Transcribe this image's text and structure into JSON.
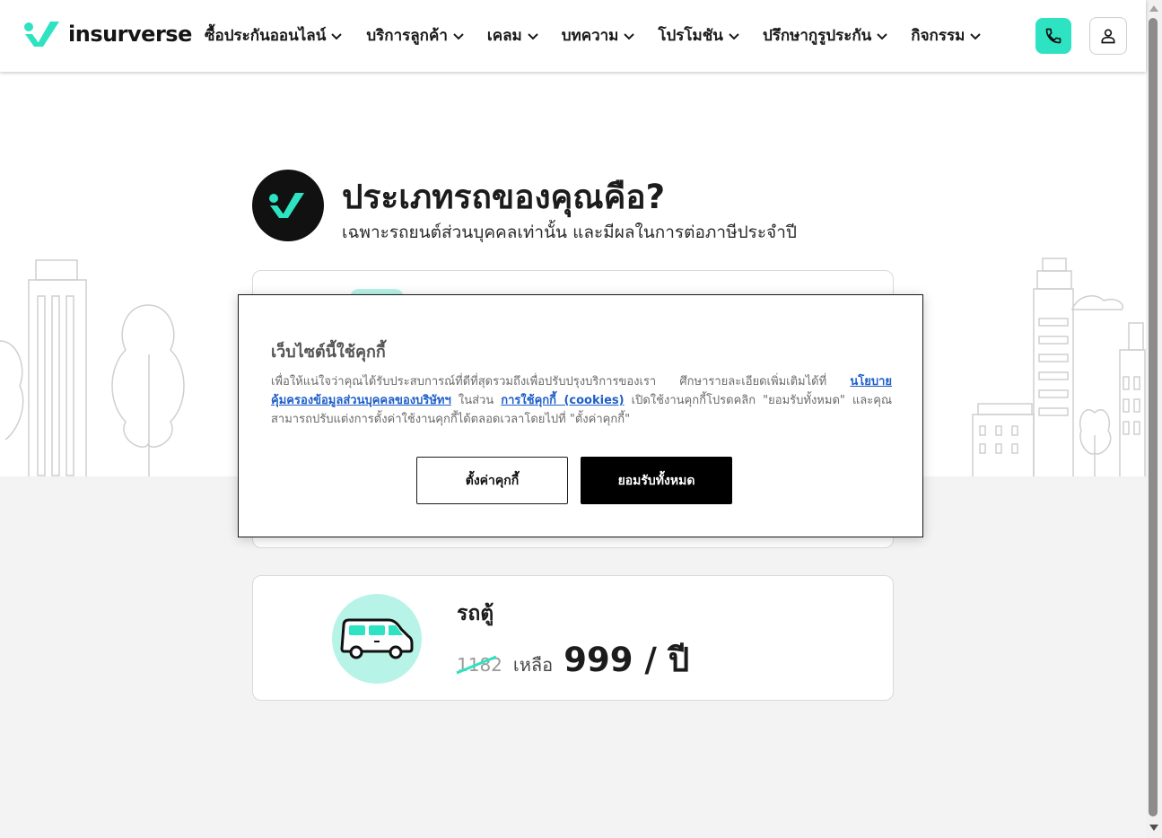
{
  "brand": {
    "name": "insurverse",
    "accent": "#2de3c1"
  },
  "nav": {
    "items": [
      {
        "label": "ซื้อประกันออนไลน์"
      },
      {
        "label": "บริการลูกค้า"
      },
      {
        "label": "เคลม"
      },
      {
        "label": "บทความ"
      },
      {
        "label": "โปรโมชัน"
      },
      {
        "label": "ปรึกษากูรูประกัน"
      },
      {
        "label": "กิจกรรม"
      }
    ],
    "phone_icon": "phone-icon",
    "user_icon": "user-icon"
  },
  "heading": {
    "title": "ประเภทรถของคุณคือ?",
    "subtitle": "เฉพาะรถยนต์ส่วนบุคคลเท่านั้น และมีผลในการต่อภาษีประจำปี"
  },
  "cards": [
    {
      "name": "รถตู้",
      "old_price": "1182",
      "remain_label": "เหลือ",
      "new_price": "999 / ปี",
      "icon": "van-icon"
    }
  ],
  "cookie": {
    "title": "เว็บไซต์นี้ใช้คุกกี้",
    "text_1": "เพื่อให้แน่ใจว่าคุณได้รับประสบการณ์ที่ดีที่สุดรวมถึงเพื่อปรับปรุงบริการของเรา ศึกษารายละเอียดเพิ่มเติมได้ที่",
    "link_privacy": "นโยบายคุ้มครองข้อมูลส่วนบุคคลของบริษัทฯ",
    "text_2": "ในส่วน",
    "link_cookies": "การใช้คุกกี้ (cookies)",
    "text_3": "เปิดใช้งานคุกกี้โปรดคลิก \"ยอมรับทั้งหมด\" และคุณสามารถปรับแต่งการตั้งค่าใช้งานคุกกี้ได้ตลอดเวลาโดยไปที่ \"ตั้งค่าคุกกี้\"",
    "settings_label": "ตั้งค่าคุกกี้",
    "accept_label": "ยอมรับทั้งหมด"
  }
}
